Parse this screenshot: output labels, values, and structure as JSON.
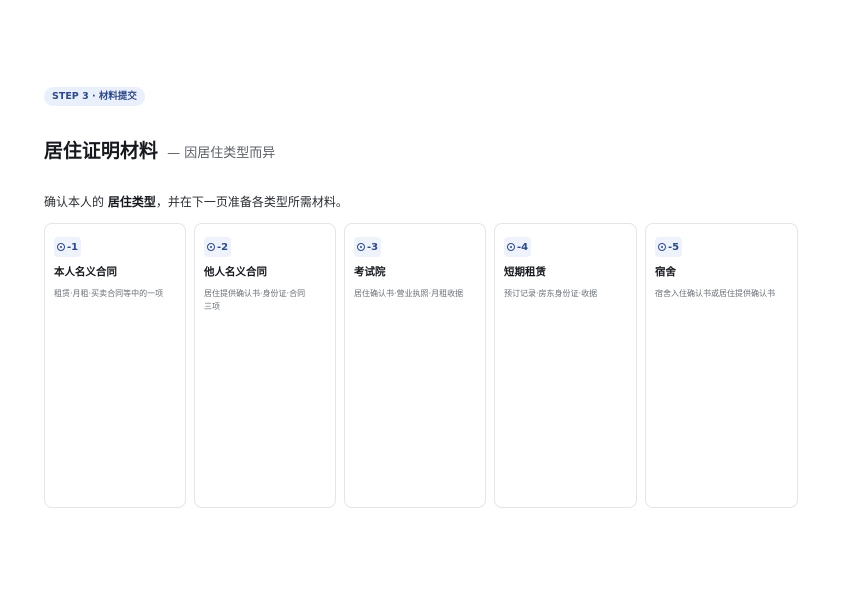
{
  "step_badge": "STEP 3 · 材料提交",
  "heading": {
    "title": "居住证明材料",
    "subtitle": "— 因居住类型而异"
  },
  "intro": {
    "prefix": "确认本人的 ",
    "emphasis": "居住类型",
    "suffix": "，并在下一页准备各类型所需材料。"
  },
  "cards": [
    {
      "code": "-1",
      "title": "本人名义合同",
      "desc": "租赁·月租·买卖合同等中的一项"
    },
    {
      "code": "-2",
      "title": "他人名义合同",
      "desc": "居住提供确认书·身份证·合同 三项"
    },
    {
      "code": "-3",
      "title": "考试院",
      "desc": "居住确认书·营业执照·月租收据"
    },
    {
      "code": "-4",
      "title": "短期租赁",
      "desc": "预订记录·房东身份证·收据"
    },
    {
      "code": "-5",
      "title": "宿舍",
      "desc": "宿舍入住确认书或居住提供确认书"
    }
  ],
  "colors": {
    "accent": "#2f4a86",
    "badge_bg": "#eaf0fb",
    "card_border": "#e3e5e8"
  },
  "icons": {
    "card_code": "target-icon"
  }
}
